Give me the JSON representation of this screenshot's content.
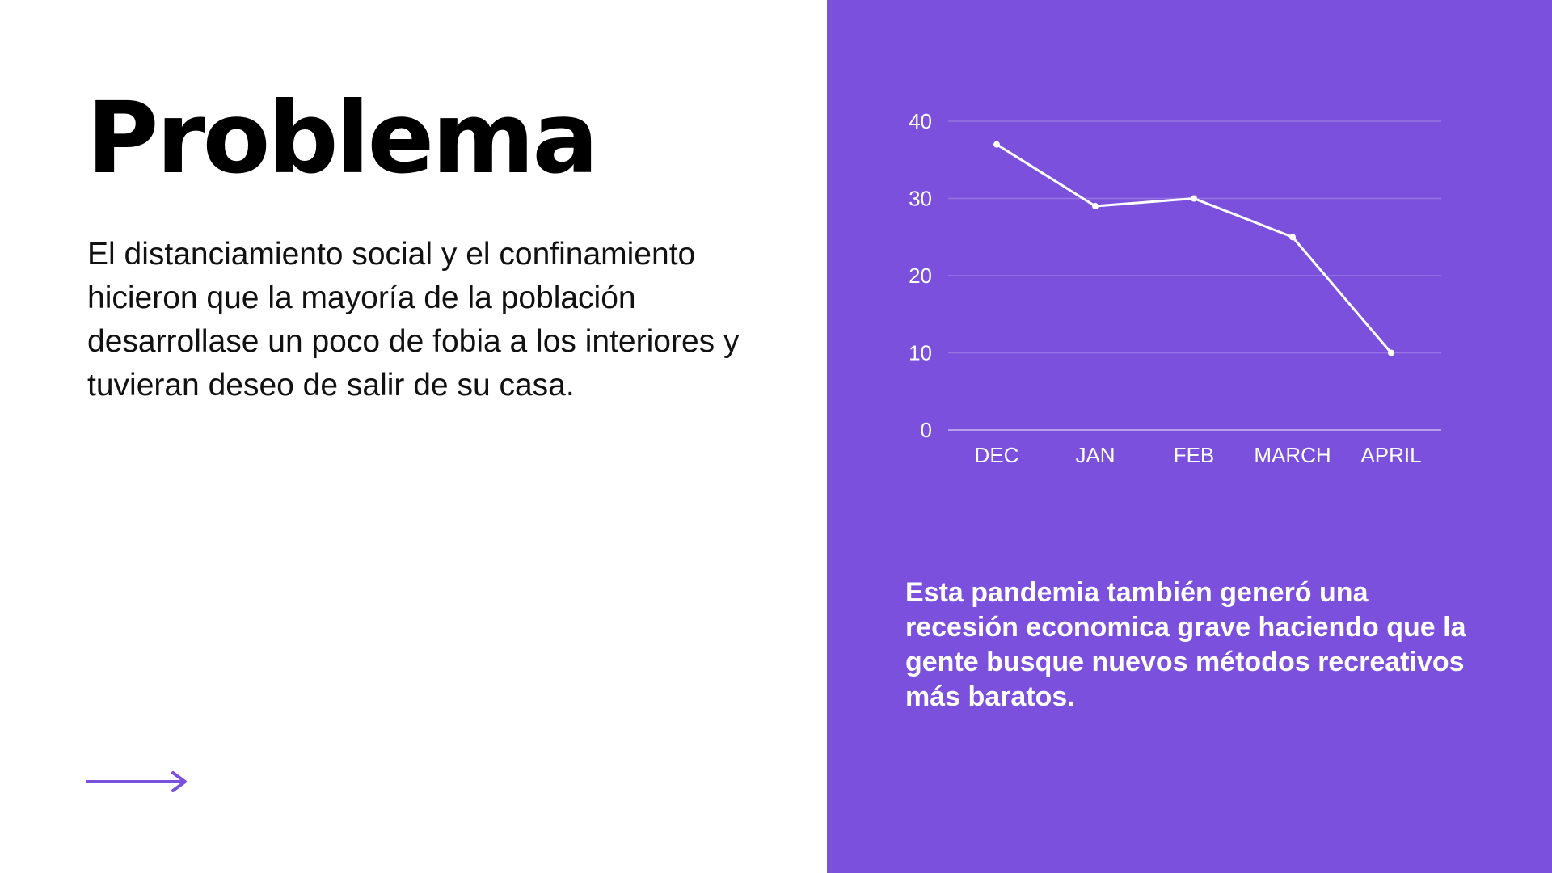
{
  "slide": {
    "title": "Problema",
    "body": "El distanciamiento social y el confinamiento hicieron que la mayoría de la población desarrollase un poco de fobia a los interiores y tuvieran deseo de salir de su casa.",
    "callout": "Esta pandemia también generó una recesión economica grave haciendo que la gente busque nuevos métodos recreativos más baratos."
  },
  "colors": {
    "accent": "#7a50dc",
    "background": "#ffffff",
    "title": "#000000",
    "chart_line": "#ffffff"
  },
  "icons": {
    "next": "arrow-right-icon"
  },
  "chart_data": {
    "type": "line",
    "title": "",
    "xlabel": "",
    "ylabel": "",
    "categories": [
      "DEC",
      "JAN",
      "FEB",
      "MARCH",
      "APRIL"
    ],
    "series": [
      {
        "values": [
          37,
          29,
          30,
          25,
          10
        ]
      }
    ],
    "ylim": [
      0,
      40
    ],
    "yticks": [
      0,
      10,
      20,
      30,
      40
    ],
    "grid": true,
    "legend": "none"
  }
}
